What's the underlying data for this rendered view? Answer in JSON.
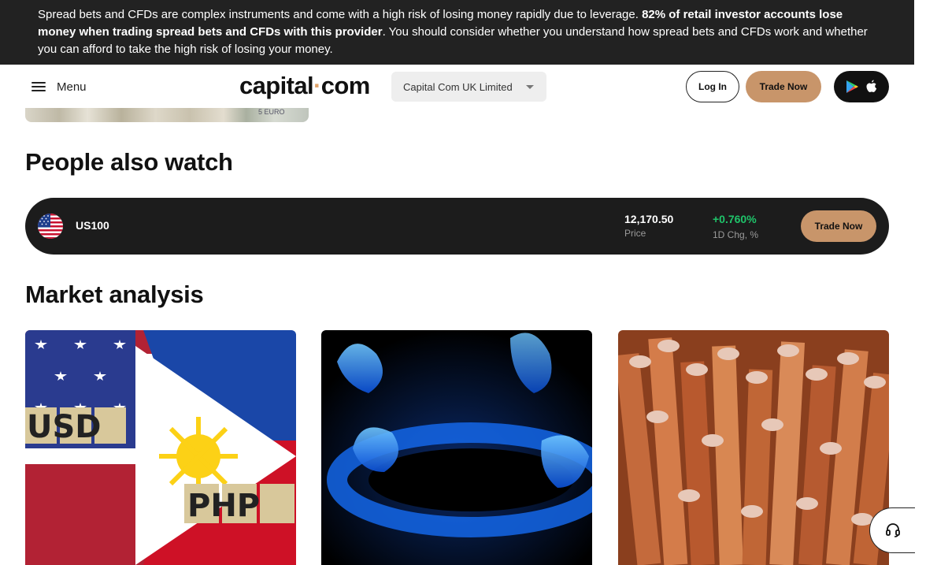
{
  "risk_banner": {
    "text_start": "Spread bets and CFDs are complex instruments and come with a high risk of losing money rapidly due to leverage. ",
    "text_bold": "82% of retail investor accounts lose money when trading spread bets and CFDs with this provider",
    "text_end": ". You should consider whether you understand how spread bets and CFDs work and whether you can afford to take the high risk of losing your money."
  },
  "header": {
    "menu_label": "Menu",
    "logo_left": "capital",
    "logo_dot": "·",
    "logo_right": "com",
    "entity_select_value": "Capital Com UK Limited",
    "login_label": "Log In",
    "trade_now_label": "Trade Now"
  },
  "hero_strip": {
    "note_text": "5 EURO"
  },
  "people_also_watch": {
    "title": "People also watch",
    "item": {
      "symbol": "US100",
      "price": "12,170.50",
      "price_label": "Price",
      "change": "+0.760%",
      "change_label": "1D Chg, %",
      "trade_label": "Trade Now"
    }
  },
  "market_analysis": {
    "title": "Market analysis",
    "cards": [
      {
        "image": "usd-php-flags",
        "tile_text_1": "USD",
        "tile_text_2": "PHP"
      },
      {
        "image": "gas-flame"
      },
      {
        "image": "copper-wires"
      }
    ]
  },
  "icons": {
    "menu": "hamburger-icon",
    "caret": "chevron-down-icon",
    "google_play": "google-play-icon",
    "apple": "apple-icon",
    "support": "headset-icon"
  },
  "colors": {
    "banner_bg": "#222222",
    "accent": "#c8956a",
    "positive": "#1fc46a",
    "card_dark": "#1c1c1c"
  }
}
